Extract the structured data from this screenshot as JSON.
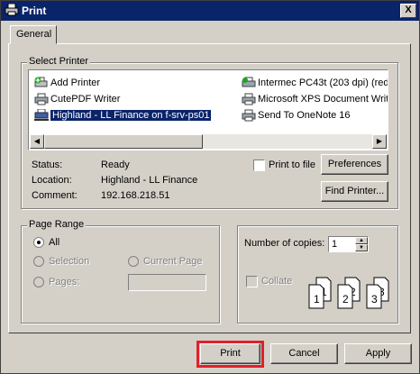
{
  "window": {
    "title": "Print",
    "close_label": "X"
  },
  "tabs": [
    {
      "label": "General"
    }
  ],
  "select_printer": {
    "group_label": "Select Printer",
    "printers_left": [
      {
        "label": "Add Printer",
        "icon": "add-printer-icon"
      },
      {
        "label": "CutePDF Writer",
        "icon": "printer-icon"
      },
      {
        "label": "Highland - LL Finance on f-srv-ps01",
        "icon": "network-printer-icon",
        "selected": true
      }
    ],
    "printers_right": [
      {
        "label": "Intermec PC43t (203 dpi) (redire",
        "icon": "printer-icon"
      },
      {
        "label": "Microsoft XPS Document Write",
        "icon": "printer-icon"
      },
      {
        "label": "Send To OneNote 16",
        "icon": "printer-icon"
      }
    ],
    "status_label": "Status:",
    "status_value": "Ready",
    "location_label": "Location:",
    "location_value": "Highland - LL Finance",
    "comment_label": "Comment:",
    "comment_value": "192.168.218.51",
    "print_to_file_label": "Print to file",
    "print_to_file_checked": false,
    "preferences_label": "Preferences",
    "find_printer_label": "Find Printer..."
  },
  "page_range": {
    "group_label": "Page Range",
    "all_label": "All",
    "selection_label": "Selection",
    "current_page_label": "Current Page",
    "pages_label": "Pages:",
    "pages_value": "",
    "selected": "All"
  },
  "copies": {
    "number_label": "Number of copies:",
    "number_value": "1",
    "collate_label": "Collate",
    "collate_checked": false
  },
  "buttons": {
    "print_label": "Print",
    "cancel_label": "Cancel",
    "apply_label": "Apply"
  },
  "colors": {
    "titlebar": "#0a246a",
    "dialog_bg": "#d4d0c8",
    "selection_bg": "#0a246a",
    "highlight_border": "#e0202a"
  }
}
